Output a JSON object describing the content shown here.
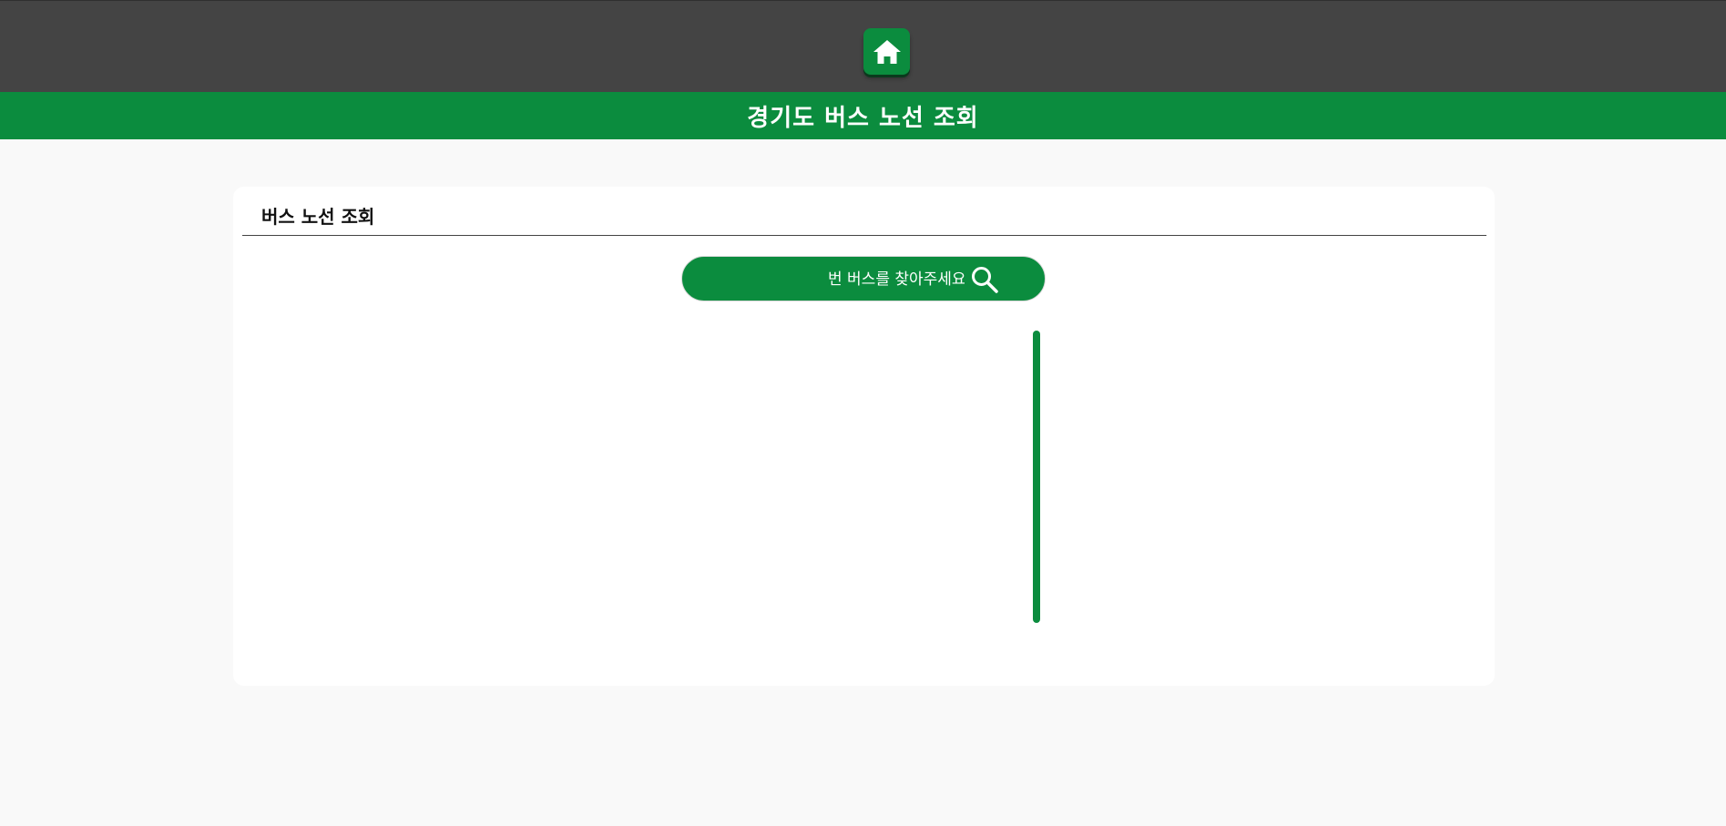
{
  "header": {
    "home_icon": "home-icon",
    "title": "경기도 버스 노선 조회"
  },
  "colors": {
    "topbar": "#444444",
    "brand_green": "#0b8c3e",
    "background": "#f9f9f9"
  },
  "card": {
    "title": "버스 노선 조회",
    "search": {
      "value": "",
      "placeholder": "번 버스를 찾아주세요",
      "icon": "search-icon"
    },
    "route_line_icon": "route-line"
  }
}
